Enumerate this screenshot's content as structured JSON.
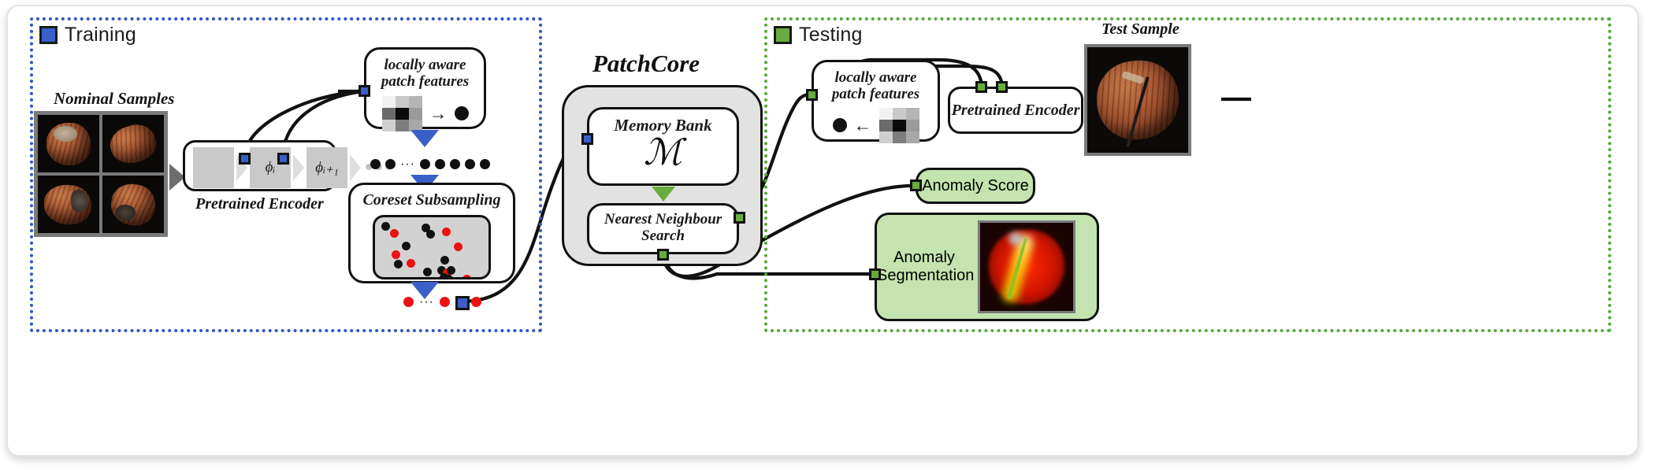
{
  "figure": {
    "center_title": "PatchCore"
  },
  "training": {
    "badge_label": "Training",
    "badge_color": "#3a5fc8",
    "nominal_caption": "Nominal Samples",
    "encoder_caption": "Pretrained Encoder",
    "encoder_blocks": [
      "",
      "ϕᵢ",
      "ϕᵢ₊₁"
    ],
    "encoder_trailing": "•••",
    "patch_box": {
      "line1": "locally aware",
      "line2": "patch features",
      "arrow": "→"
    },
    "coreset": {
      "title": "Coreset Subsampling"
    }
  },
  "patchcore": {
    "memory_bank": {
      "title": "Memory Bank",
      "symbol": "ℳ"
    },
    "nearest_neighbour": {
      "line1": "Nearest Neighbour",
      "line2": "Search"
    }
  },
  "testing": {
    "badge_label": "Testing",
    "badge_color": "#68ac3f",
    "patch_box": {
      "line1": "locally aware",
      "line2": "patch features",
      "arrow": "←"
    },
    "encoder_label": "Pretrained Encoder",
    "test_sample_caption": "Test Sample",
    "anomaly_score_label": "Anomaly Score",
    "anomaly_segmentation": {
      "line1": "Anomaly",
      "line2": "Segmentation"
    }
  },
  "colors": {
    "train_accent": "#2f55c4",
    "test_accent": "#55a83c",
    "chip_blue": "#3a5fc8",
    "chip_green": "#68ac3f",
    "coreset_red": "#ee1111",
    "coreset_black": "#111111",
    "patchcore_fill": "#e2e2e2",
    "result_fill": "#c4e3ae"
  }
}
